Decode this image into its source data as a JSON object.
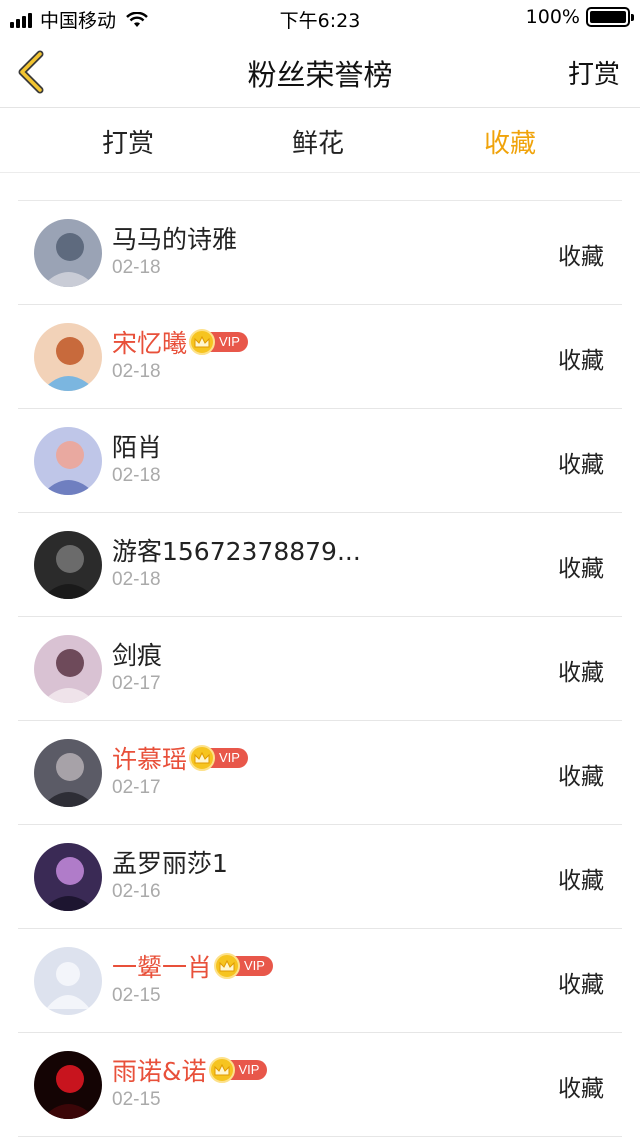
{
  "status_bar": {
    "carrier": "中国移动",
    "time": "下午6:23",
    "battery": "100%"
  },
  "nav": {
    "title": "粉丝荣誉榜",
    "action": "打赏"
  },
  "tabs": [
    {
      "label": "打赏",
      "active": false
    },
    {
      "label": "鲜花",
      "active": false
    },
    {
      "label": "收藏",
      "active": true
    }
  ],
  "colors": {
    "accent": "#f0a30a",
    "vip_name": "#e8503a",
    "vip_tag": "#e8574a",
    "crown": "#f6c420"
  },
  "vip_label": "VIP",
  "rows": [
    {
      "name": "马马的诗雅",
      "date": "02-18",
      "action": "收藏",
      "vip": false,
      "avatar": "photo-avatar"
    },
    {
      "name": "宋忆曦",
      "date": "02-18",
      "action": "收藏",
      "vip": true,
      "avatar": "photo-avatar"
    },
    {
      "name": "陌肖",
      "date": "02-18",
      "action": "收藏",
      "vip": false,
      "avatar": "photo-avatar"
    },
    {
      "name": "游客15672378879...",
      "date": "02-18",
      "action": "收藏",
      "vip": false,
      "avatar": "photo-avatar"
    },
    {
      "name": "剑痕",
      "date": "02-17",
      "action": "收藏",
      "vip": false,
      "avatar": "photo-avatar"
    },
    {
      "name": "许慕瑶",
      "date": "02-17",
      "action": "收藏",
      "vip": true,
      "avatar": "photo-avatar"
    },
    {
      "name": "孟罗丽莎1",
      "date": "02-16",
      "action": "收藏",
      "vip": false,
      "avatar": "photo-avatar"
    },
    {
      "name": "一颦一肖",
      "date": "02-15",
      "action": "收藏",
      "vip": true,
      "avatar": "default-avatar"
    },
    {
      "name": "雨诺&诺",
      "date": "02-15",
      "action": "收藏",
      "vip": true,
      "avatar": "photo-avatar"
    }
  ]
}
